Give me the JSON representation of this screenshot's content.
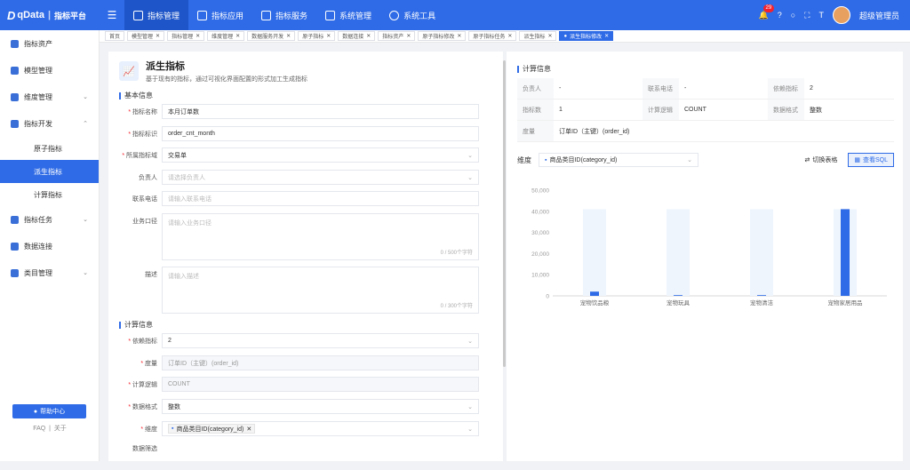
{
  "topbar": {
    "logo": "qData",
    "logo_sub": "指标平台",
    "nav": [
      {
        "label": "指标管理",
        "active": true
      },
      {
        "label": "指标应用",
        "active": false
      },
      {
        "label": "指标服务",
        "active": false
      },
      {
        "label": "系统管理",
        "active": false
      },
      {
        "label": "系统工具",
        "active": false
      }
    ],
    "notify_count": "29",
    "user_name": "超级管理员"
  },
  "tabs": [
    {
      "label": "首页",
      "closable": false,
      "active": false
    },
    {
      "label": "模型管理",
      "closable": true,
      "active": false
    },
    {
      "label": "指标管理",
      "closable": true,
      "active": false
    },
    {
      "label": "维度管理",
      "closable": true,
      "active": false
    },
    {
      "label": "数据服务开发",
      "closable": true,
      "active": false
    },
    {
      "label": "原子指标",
      "closable": true,
      "active": false
    },
    {
      "label": "数据连接",
      "closable": true,
      "active": false
    },
    {
      "label": "指标资产",
      "closable": true,
      "active": false
    },
    {
      "label": "原子指标修改",
      "closable": true,
      "active": false
    },
    {
      "label": "原子指标任务",
      "closable": true,
      "active": false
    },
    {
      "label": "派生指标",
      "closable": true,
      "active": false
    },
    {
      "label": "派生指标修改",
      "closable": true,
      "active": true
    }
  ],
  "sidebar": {
    "items": [
      {
        "label": "指标资产",
        "chevron": ""
      },
      {
        "label": "模型管理",
        "chevron": ""
      },
      {
        "label": "维度管理",
        "chevron": "⌄"
      },
      {
        "label": "指标开发",
        "chevron": "⌃"
      }
    ],
    "sub_items": [
      {
        "label": "原子指标",
        "active": false
      },
      {
        "label": "派生指标",
        "active": true
      },
      {
        "label": "计算指标",
        "active": false
      }
    ],
    "items2": [
      {
        "label": "指标任务",
        "chevron": "⌄"
      },
      {
        "label": "数据连接",
        "chevron": ""
      },
      {
        "label": "类目管理",
        "chevron": "⌄"
      }
    ],
    "help_label": "帮助中心",
    "faq": "FAQ",
    "about": "关于"
  },
  "form": {
    "title": "派生指标",
    "subtitle": "基于现有的指标，通过可视化界面配置的形式加工生成指标",
    "section_basic": "基本信息",
    "section_calc": "计算信息",
    "fields": {
      "name": {
        "label": "指标名称",
        "value": "本月订单数"
      },
      "code": {
        "label": "指标标识",
        "value": "order_cnt_month"
      },
      "domain": {
        "label": "所属指标域",
        "value": "交易单"
      },
      "owner": {
        "label": "负责人",
        "placeholder": "请选择负责人"
      },
      "phone": {
        "label": "联系电话",
        "placeholder": "请输入联系电话"
      },
      "caliber": {
        "label": "业务口径",
        "placeholder": "请输入业务口径",
        "count": "0 / 500个字符"
      },
      "desc": {
        "label": "描述",
        "placeholder": "请输入描述",
        "count": "0 / 300个字符"
      },
      "dep": {
        "label": "依赖指标",
        "value": "2"
      },
      "measure": {
        "label": "度量",
        "value": "订单ID（主键）(order_id)"
      },
      "logic": {
        "label": "计算逻辑",
        "value": "COUNT"
      },
      "format": {
        "label": "数据格式",
        "value": "整数"
      },
      "dimension": {
        "label": "维度",
        "value": "商品类目ID(category_id)"
      },
      "filter": {
        "label": "数据筛选"
      }
    }
  },
  "right": {
    "title": "计算信息",
    "info": [
      [
        {
          "k": "负责人",
          "v": "-"
        },
        {
          "k": "联系电话",
          "v": "-"
        },
        {
          "k": "依赖指标",
          "v": "2"
        }
      ],
      [
        {
          "k": "指标数",
          "v": "1"
        },
        {
          "k": "计算逻辑",
          "v": "COUNT"
        },
        {
          "k": "数据格式",
          "v": "整数"
        }
      ],
      [
        {
          "k": "度量",
          "v": "订单ID（主键）(order_id)"
        }
      ]
    ],
    "dim_label": "维度",
    "dim_value": "商品类目ID(category_id)",
    "switch_label": "切换表格",
    "sql_label": "查看SQL"
  },
  "chart_data": {
    "type": "bar",
    "categories": [
      "宠物饮品粮",
      "宠物玩具",
      "宠物清洁",
      "宠物家居用品"
    ],
    "values": [
      2000,
      200,
      100,
      41000
    ],
    "ylim": [
      0,
      50000
    ],
    "yticks": [
      "0",
      "10,000",
      "20,000",
      "30,000",
      "40,000",
      "50,000"
    ],
    "background_value": 41000,
    "bar_color": "#2f6be6",
    "bg_color": "#eef5fd"
  }
}
